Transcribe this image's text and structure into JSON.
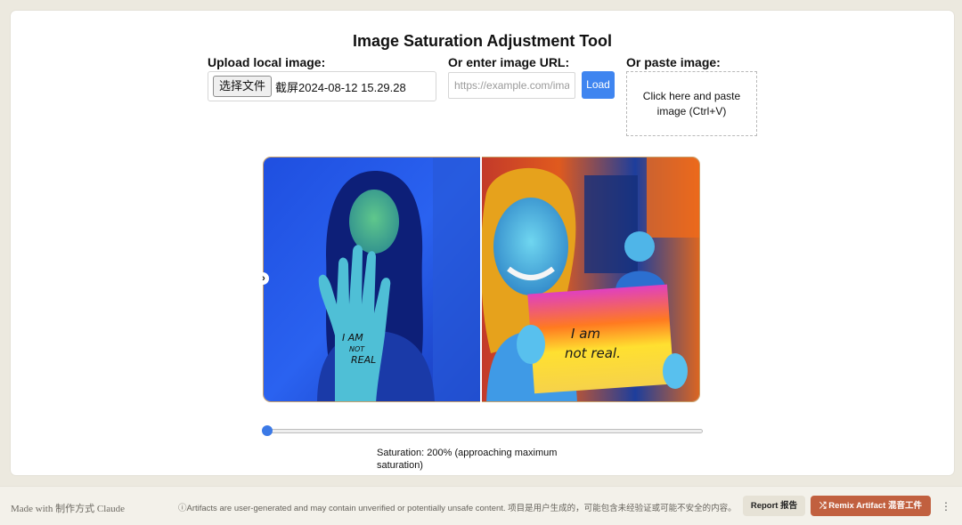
{
  "page": {
    "title": "Image Saturation Adjustment Tool"
  },
  "upload": {
    "label": "Upload local image:",
    "button_label": "选择文件",
    "file_name": "截屏2024-08-12 15.29.28"
  },
  "url": {
    "label": "Or enter image URL:",
    "placeholder": "https://example.com/image.jpg",
    "load_label": "Load"
  },
  "paste": {
    "label": "Or paste image:",
    "hint": "Click here and paste image (Ctrl+V)"
  },
  "viewer": {
    "handle_icon": "chevron-right-icon",
    "left_image": {
      "description_icon": "photo-icon",
      "sign_text": [
        "I AM",
        "NOT",
        "REAL"
      ]
    },
    "right_image": {
      "description_icon": "photo-icon",
      "sign_text": [
        "I am",
        "not real."
      ]
    }
  },
  "slider": {
    "value_fraction": 0.0
  },
  "saturation": {
    "text": "Saturation: 200% (approaching maximum saturation)"
  },
  "footer": {
    "made_with": "Made with 制作方式 Claude",
    "disclaimer": "ⓘArtifacts are user-generated and may contain unverified or potentially unsafe content. 项目是用户生成的，可能包含未经验证或可能不安全的内容。",
    "report_label": "Report 报告",
    "remix_label": "⤮ Remix Artifact 混音工件",
    "more_label": "⋮"
  },
  "colors": {
    "accent": "#3f85f0",
    "remix": "#c1603f",
    "background": "#ece9df"
  }
}
